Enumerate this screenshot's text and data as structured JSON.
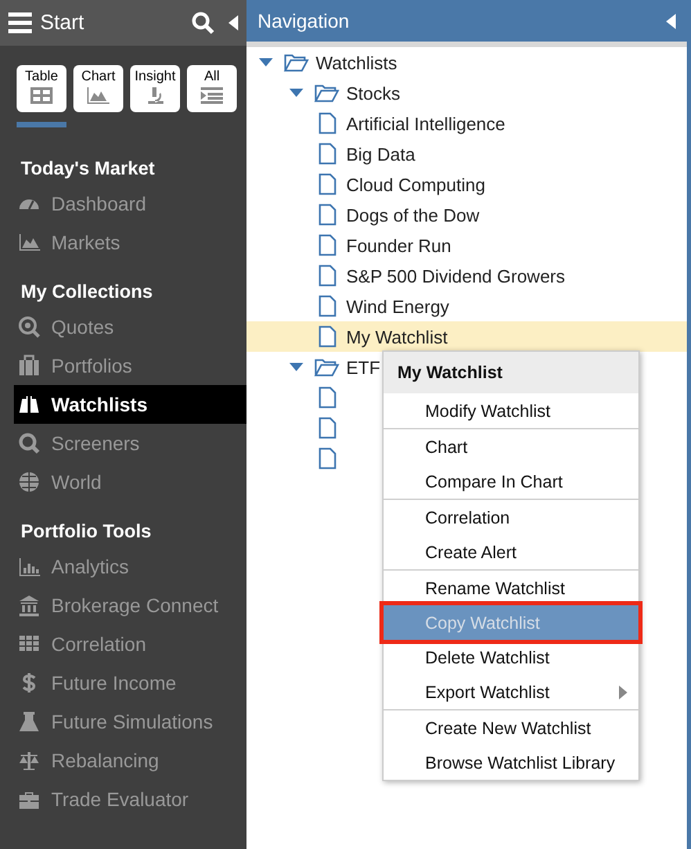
{
  "sidebar": {
    "title": "Start",
    "views": [
      {
        "label": "Table",
        "selected": true
      },
      {
        "label": "Chart",
        "selected": false
      },
      {
        "label": "Insight",
        "selected": false
      },
      {
        "label": "All",
        "selected": false
      }
    ],
    "sections": [
      {
        "heading": "Today's Market",
        "items": [
          {
            "label": "Dashboard",
            "selected": false
          },
          {
            "label": "Markets",
            "selected": false
          }
        ]
      },
      {
        "heading": "My Collections",
        "items": [
          {
            "label": "Quotes",
            "selected": false
          },
          {
            "label": "Portfolios",
            "selected": false
          },
          {
            "label": "Watchlists",
            "selected": true
          },
          {
            "label": "Screeners",
            "selected": false
          },
          {
            "label": "World",
            "selected": false
          }
        ]
      },
      {
        "heading": "Portfolio Tools",
        "items": [
          {
            "label": "Analytics",
            "selected": false
          },
          {
            "label": "Brokerage Connect",
            "selected": false
          },
          {
            "label": "Correlation",
            "selected": false
          },
          {
            "label": "Future Income",
            "selected": false
          },
          {
            "label": "Future Simulations",
            "selected": false
          },
          {
            "label": "Rebalancing",
            "selected": false
          },
          {
            "label": "Trade Evaluator",
            "selected": false
          }
        ]
      }
    ]
  },
  "navigation": {
    "title": "Navigation",
    "tree": [
      {
        "label": "Watchlists",
        "expanded": true,
        "children": [
          {
            "label": "Stocks",
            "expanded": true,
            "children": [
              {
                "label": "Artificial Intelligence",
                "selected": false
              },
              {
                "label": "Big Data",
                "selected": false
              },
              {
                "label": "Cloud Computing",
                "selected": false
              },
              {
                "label": "Dogs of the Dow",
                "selected": false
              },
              {
                "label": "Founder Run",
                "selected": false
              },
              {
                "label": "S&P 500 Dividend Growers",
                "selected": false
              },
              {
                "label": "Wind Energy",
                "selected": false
              },
              {
                "label": "My Watchlist",
                "selected": true
              }
            ]
          },
          {
            "label": "ETF",
            "expanded": true,
            "children": [
              {
                "selected": false
              },
              {
                "selected": false
              },
              {
                "selected": false
              }
            ]
          }
        ]
      }
    ]
  },
  "context_menu": {
    "title": "My Watchlist",
    "groups": [
      [
        {
          "label": "Modify Watchlist",
          "selected": false,
          "submenu": false
        }
      ],
      [
        {
          "label": "Chart",
          "selected": false,
          "submenu": false
        },
        {
          "label": "Compare In Chart",
          "selected": false,
          "submenu": false
        }
      ],
      [
        {
          "label": "Correlation",
          "selected": false,
          "submenu": false
        },
        {
          "label": "Create Alert",
          "selected": false,
          "submenu": false
        }
      ],
      [
        {
          "label": "Rename Watchlist",
          "selected": false,
          "submenu": false
        },
        {
          "label": "Copy Watchlist",
          "selected": true,
          "submenu": false
        },
        {
          "label": "Delete Watchlist",
          "selected": false,
          "submenu": false
        },
        {
          "label": "Export Watchlist",
          "selected": false,
          "submenu": true
        }
      ],
      [
        {
          "label": "Create New Watchlist",
          "selected": false,
          "submenu": false
        },
        {
          "label": "Browse Watchlist Library",
          "selected": false,
          "submenu": false
        }
      ]
    ]
  }
}
